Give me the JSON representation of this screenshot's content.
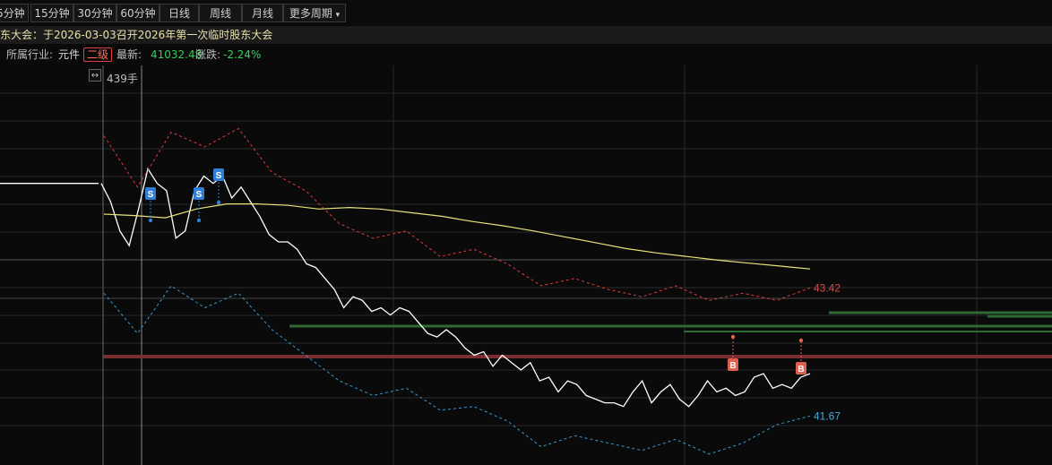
{
  "period_tabs": [
    {
      "label": "5分钟"
    },
    {
      "label": "15分钟"
    },
    {
      "label": "30分钟"
    },
    {
      "label": "60分钟"
    },
    {
      "label": "日线"
    },
    {
      "label": "周线"
    },
    {
      "label": "月线"
    },
    {
      "label": "更多周期"
    }
  ],
  "more_caret": "▾",
  "notice": "东大会：于2026-03-03召开2026年第一次临时股东大会",
  "info": {
    "industry_label": "所属行业:",
    "industry_value": "元件",
    "level_badge": "二级",
    "latest_label": "最新:",
    "latest_value": "41032.48",
    "change_label": "涨跌:",
    "change_value": "-2.24%"
  },
  "volume_label": "439手",
  "colors": {
    "price": "#ffffff",
    "average": "#e8e27a",
    "upper_band": "#e03a3a",
    "lower_band": "#3a9ad0",
    "grid": "#2a2a2a",
    "support_green": "#2e6b34",
    "resistance_red": "#7a2e30",
    "sell_marker": "#2f7fd8",
    "buy_marker": "#e06050",
    "up_text": "#ff4040",
    "down_text": "#2fd05a"
  },
  "chart_data": {
    "type": "line",
    "series": [
      {
        "name": "price",
        "values": [
          44.85,
          44.85,
          44.85,
          44.85,
          44.85,
          44.85,
          44.85,
          44.85,
          44.85,
          44.85,
          44.85,
          44.85,
          44.85,
          44.85,
          44.85,
          44.85,
          44.85,
          44.85,
          44.85,
          44.85,
          44.85,
          44.85,
          44.85,
          44.85,
          44.85,
          44.85,
          44.85,
          44.85,
          44.85,
          44.85,
          44.85,
          44.85,
          44.85,
          44.85,
          44.85,
          44.6,
          44.2,
          44.0,
          44.5,
          45.05,
          44.85,
          44.75,
          44.1,
          44.2,
          44.75,
          44.95,
          44.85,
          44.95,
          44.65,
          44.8,
          44.6,
          44.4,
          44.15,
          44.05,
          44.05,
          43.95,
          43.75,
          43.7,
          43.55,
          43.4,
          43.15,
          43.3,
          43.25,
          43.1,
          43.15,
          43.05,
          43.15,
          43.1,
          42.95,
          42.8,
          42.75,
          42.85,
          42.75,
          42.6,
          42.5,
          42.55,
          42.35,
          42.5,
          42.4,
          42.3,
          42.4,
          42.15,
          42.2,
          42.0,
          42.15,
          42.1,
          41.95,
          41.9,
          41.85,
          41.85,
          41.8,
          42.0,
          42.15,
          41.85,
          42.0,
          42.1,
          41.9,
          41.8,
          41.95,
          42.15,
          42.0,
          42.05,
          41.95,
          42.0,
          42.2,
          42.25,
          42.05,
          42.1,
          42.05,
          42.2,
          42.25
        ],
        "note_values": []
      },
      {
        "name": "average",
        "values": [
          44.43,
          44.41,
          44.38,
          44.5,
          44.57,
          44.57,
          44.55,
          44.5,
          44.52,
          44.5,
          44.45,
          44.4,
          44.33,
          44.27,
          44.2,
          44.12,
          44.04,
          43.96,
          43.9,
          43.85,
          43.8,
          43.76,
          43.72,
          43.68
        ]
      },
      {
        "name": "upper_band",
        "values": [
          45.5,
          44.8,
          45.55,
          45.35,
          45.6,
          45.0,
          44.75,
          44.3,
          44.1,
          44.2,
          43.85,
          43.95,
          43.75,
          43.45,
          43.55,
          43.4,
          43.3,
          43.45,
          43.25,
          43.35,
          43.25,
          43.42
        ]
      },
      {
        "name": "lower_band",
        "values": [
          43.35,
          42.8,
          43.45,
          43.15,
          43.35,
          42.85,
          42.5,
          42.15,
          41.95,
          42.05,
          41.75,
          41.8,
          41.6,
          41.25,
          41.4,
          41.3,
          41.2,
          41.35,
          41.15,
          41.3,
          41.55,
          41.67
        ]
      }
    ],
    "annotations": [
      {
        "text": "S",
        "kind": "sell"
      },
      {
        "text": "S",
        "kind": "sell"
      },
      {
        "text": "S",
        "kind": "sell"
      },
      {
        "text": "B",
        "kind": "buy"
      },
      {
        "text": "B",
        "kind": "buy"
      }
    ],
    "labels": {
      "upper_last": "43.42",
      "lower_last": "41.67"
    }
  }
}
